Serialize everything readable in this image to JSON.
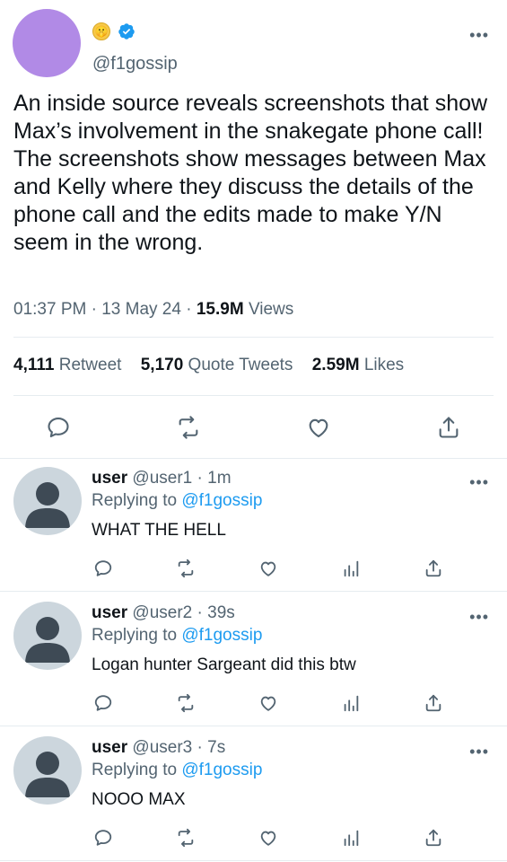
{
  "tweet": {
    "emoji": "🤫",
    "handle": "@f1gossip",
    "more": "•••",
    "text": "An inside source reveals screenshots that show Max’s involvement in the snakegate phone call! The screenshots show messages between Max and Kelly where they discuss the details of the phone call and the edits made to make Y/N seem in the wrong.",
    "time": "01:37 PM",
    "date": "13 May 24",
    "views_count": "15.9M",
    "views_label": "Views",
    "sep": "·",
    "retweets_count": "4,111",
    "retweets_label": "Retweet",
    "quotes_count": "5,170",
    "quotes_label": "Quote Tweets",
    "likes_count": "2.59M",
    "likes_label": "Likes"
  },
  "replies": [
    {
      "name": "user",
      "handle": "@user1",
      "age": "1m",
      "replying_prefix": "Replying to",
      "replying_to": "@f1gossip",
      "text": "WHAT THE HELL"
    },
    {
      "name": "user",
      "handle": "@user2",
      "age": "39s",
      "replying_prefix": "Replying to",
      "replying_to": "@f1gossip",
      "text": "Logan hunter Sargeant did this btw"
    },
    {
      "name": "user",
      "handle": "@user3",
      "age": "7s",
      "replying_prefix": "Replying to",
      "replying_to": "@f1gossip",
      "text": "NOOO MAX"
    }
  ],
  "icons": {
    "reply": "reply-icon",
    "retweet": "retweet-icon",
    "like": "heart-icon",
    "share": "share-icon",
    "analytics": "analytics-icon",
    "verified": "verified-badge-icon"
  },
  "colors": {
    "accent": "#1d9bf0",
    "avatar": "#b18ae6",
    "muted": "#536471"
  }
}
